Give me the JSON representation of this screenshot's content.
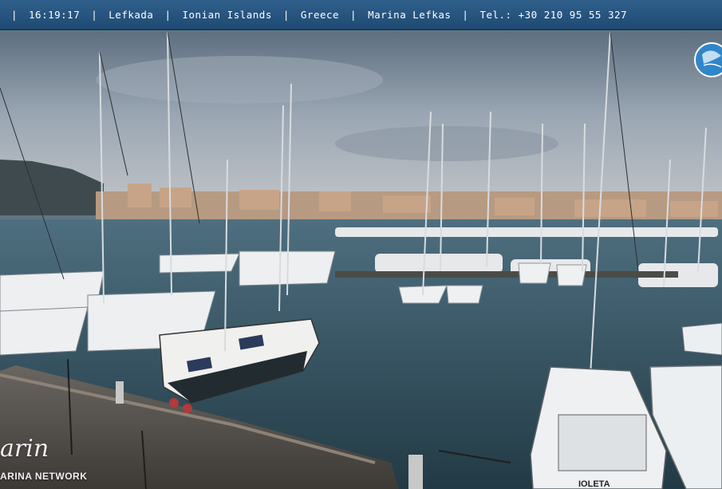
{
  "header": {
    "time": "16:19:17",
    "location": "Lefkada",
    "region": "Ionian Islands",
    "country": "Greece",
    "marina": "Marina Lefkas",
    "phone": "Tel.: +30 210 95 55 327",
    "separator": "|"
  },
  "scene": {
    "boat_name": "IOLETA",
    "icons": [
      "globe-logo-icon",
      "marina-network-logo"
    ]
  },
  "watermark": {
    "script_text": "arin",
    "network_text": "ARINA NETWORK"
  }
}
